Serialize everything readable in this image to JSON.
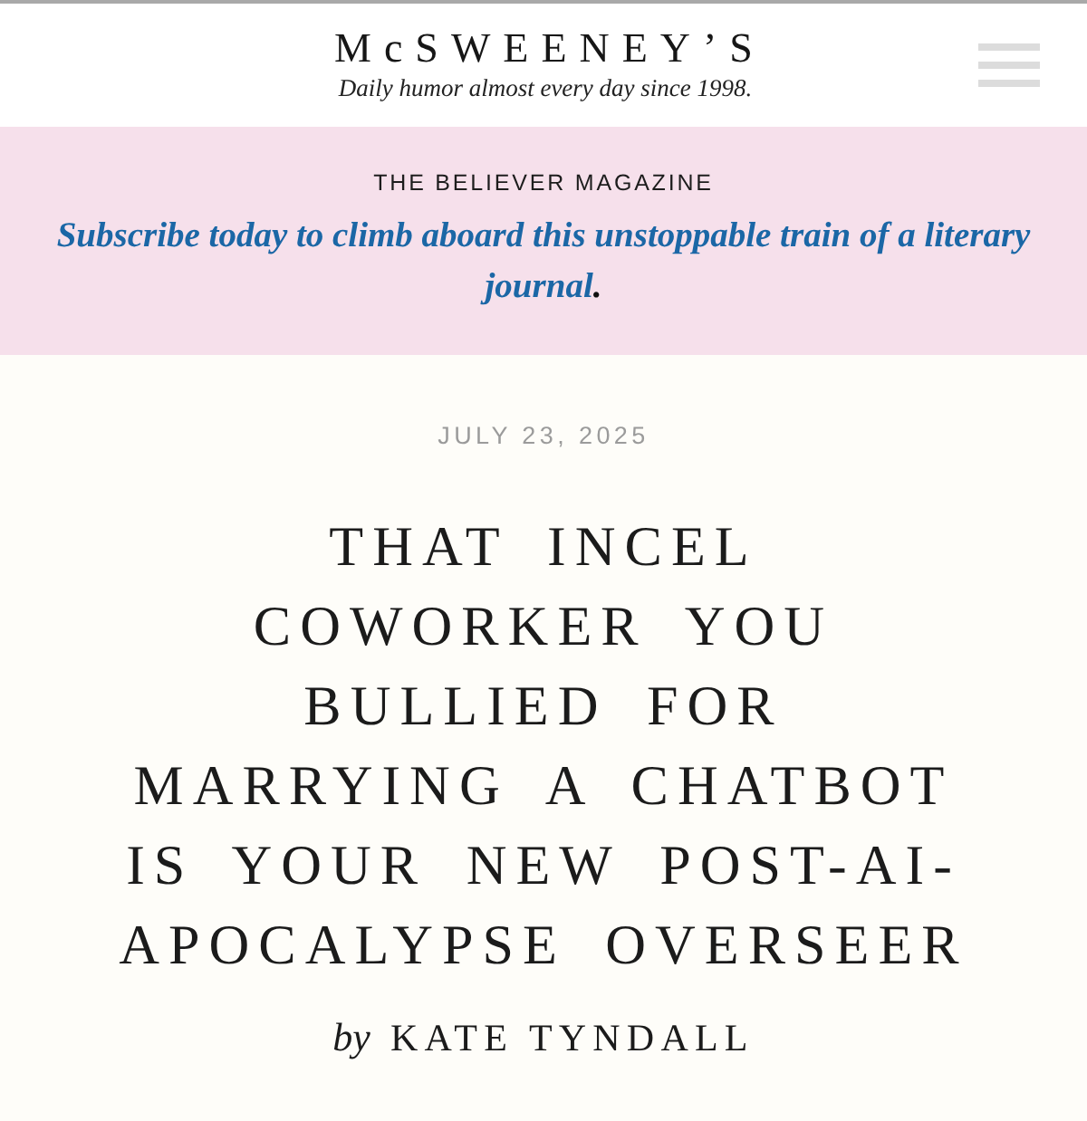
{
  "header": {
    "logo": "McSWEENEY’S",
    "tagline": "Daily humor almost every day since 1998."
  },
  "promo": {
    "label": "THE BELIEVER MAGAZINE",
    "link": "Subscribe today to climb aboard this unstoppable train of a literary journal",
    "end": "."
  },
  "article": {
    "date": "JULY 23, 2025",
    "title": "THAT INCEL COWORKER YOU BULLIED FOR MARRYING A CHATBOT IS YOUR NEW POST-AI-APOCALYPSE OVERSEER",
    "byline": {
      "prefix": "by",
      "author": "KATE TYNDALL"
    }
  }
}
